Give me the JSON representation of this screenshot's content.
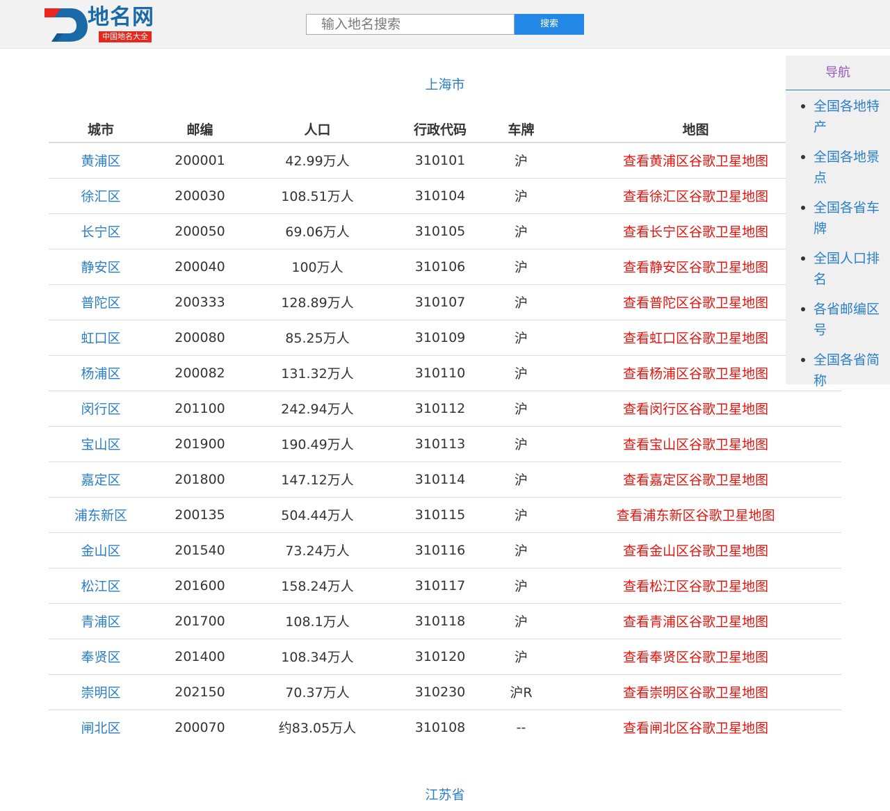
{
  "header": {
    "logo_title": "地名网",
    "logo_subtitle": "中国地名大全",
    "search_placeholder": "输入地名搜索",
    "search_button": "搜索"
  },
  "sections": [
    {
      "title": "上海市",
      "columns": [
        "城市",
        "邮编",
        "人口",
        "行政代码",
        "车牌",
        "地图"
      ],
      "rows": [
        {
          "city": "黄浦区",
          "zip": "200001",
          "population": "42.99万人",
          "code": "310101",
          "plate": "沪",
          "map": "查看黄浦区谷歌卫星地图"
        },
        {
          "city": "徐汇区",
          "zip": "200030",
          "population": "108.51万人",
          "code": "310104",
          "plate": "沪",
          "map": "查看徐汇区谷歌卫星地图"
        },
        {
          "city": "长宁区",
          "zip": "200050",
          "population": "69.06万人",
          "code": "310105",
          "plate": "沪",
          "map": "查看长宁区谷歌卫星地图"
        },
        {
          "city": "静安区",
          "zip": "200040",
          "population": "100万人",
          "code": "310106",
          "plate": "沪",
          "map": "查看静安区谷歌卫星地图"
        },
        {
          "city": "普陀区",
          "zip": "200333",
          "population": "128.89万人",
          "code": "310107",
          "plate": "沪",
          "map": "查看普陀区谷歌卫星地图"
        },
        {
          "city": "虹口区",
          "zip": "200080",
          "population": "85.25万人",
          "code": "310109",
          "plate": "沪",
          "map": "查看虹口区谷歌卫星地图"
        },
        {
          "city": "杨浦区",
          "zip": "200082",
          "population": "131.32万人",
          "code": "310110",
          "plate": "沪",
          "map": "查看杨浦区谷歌卫星地图"
        },
        {
          "city": "闵行区",
          "zip": "201100",
          "population": "242.94万人",
          "code": "310112",
          "plate": "沪",
          "map": "查看闵行区谷歌卫星地图"
        },
        {
          "city": "宝山区",
          "zip": "201900",
          "population": "190.49万人",
          "code": "310113",
          "plate": "沪",
          "map": "查看宝山区谷歌卫星地图"
        },
        {
          "city": "嘉定区",
          "zip": "201800",
          "population": "147.12万人",
          "code": "310114",
          "plate": "沪",
          "map": "查看嘉定区谷歌卫星地图"
        },
        {
          "city": "浦东新区",
          "zip": "200135",
          "population": "504.44万人",
          "code": "310115",
          "plate": "沪",
          "map": "查看浦东新区谷歌卫星地图"
        },
        {
          "city": "金山区",
          "zip": "201540",
          "population": "73.24万人",
          "code": "310116",
          "plate": "沪",
          "map": "查看金山区谷歌卫星地图"
        },
        {
          "city": "松江区",
          "zip": "201600",
          "population": "158.24万人",
          "code": "310117",
          "plate": "沪",
          "map": "查看松江区谷歌卫星地图"
        },
        {
          "city": "青浦区",
          "zip": "201700",
          "population": "108.1万人",
          "code": "310118",
          "plate": "沪",
          "map": "查看青浦区谷歌卫星地图"
        },
        {
          "city": "奉贤区",
          "zip": "201400",
          "population": "108.34万人",
          "code": "310120",
          "plate": "沪",
          "map": "查看奉贤区谷歌卫星地图"
        },
        {
          "city": "崇明区",
          "zip": "202150",
          "population": "70.37万人",
          "code": "310230",
          "plate": "沪R",
          "map": "查看崇明区谷歌卫星地图"
        },
        {
          "city": "闸北区",
          "zip": "200070",
          "population": "约83.05万人",
          "code": "310108",
          "plate": "--",
          "map": "查看闸北区谷歌卫星地图"
        }
      ]
    },
    {
      "title": "江苏省"
    }
  ],
  "nav": {
    "title": "导航",
    "items": [
      "全国各地特产",
      "全国各地景点",
      "全国各省车牌",
      "全国人口排名",
      "各省邮编区号",
      "全国各省简称"
    ]
  },
  "colors": {
    "header_bg": "#f2f2f2",
    "link_blue": "#2a7fc8",
    "map_link_red": "#e8130c",
    "search_button_bg": "#2489e6",
    "nav_title_purple": "#9a5ab8",
    "logo_red": "#e8281f"
  }
}
